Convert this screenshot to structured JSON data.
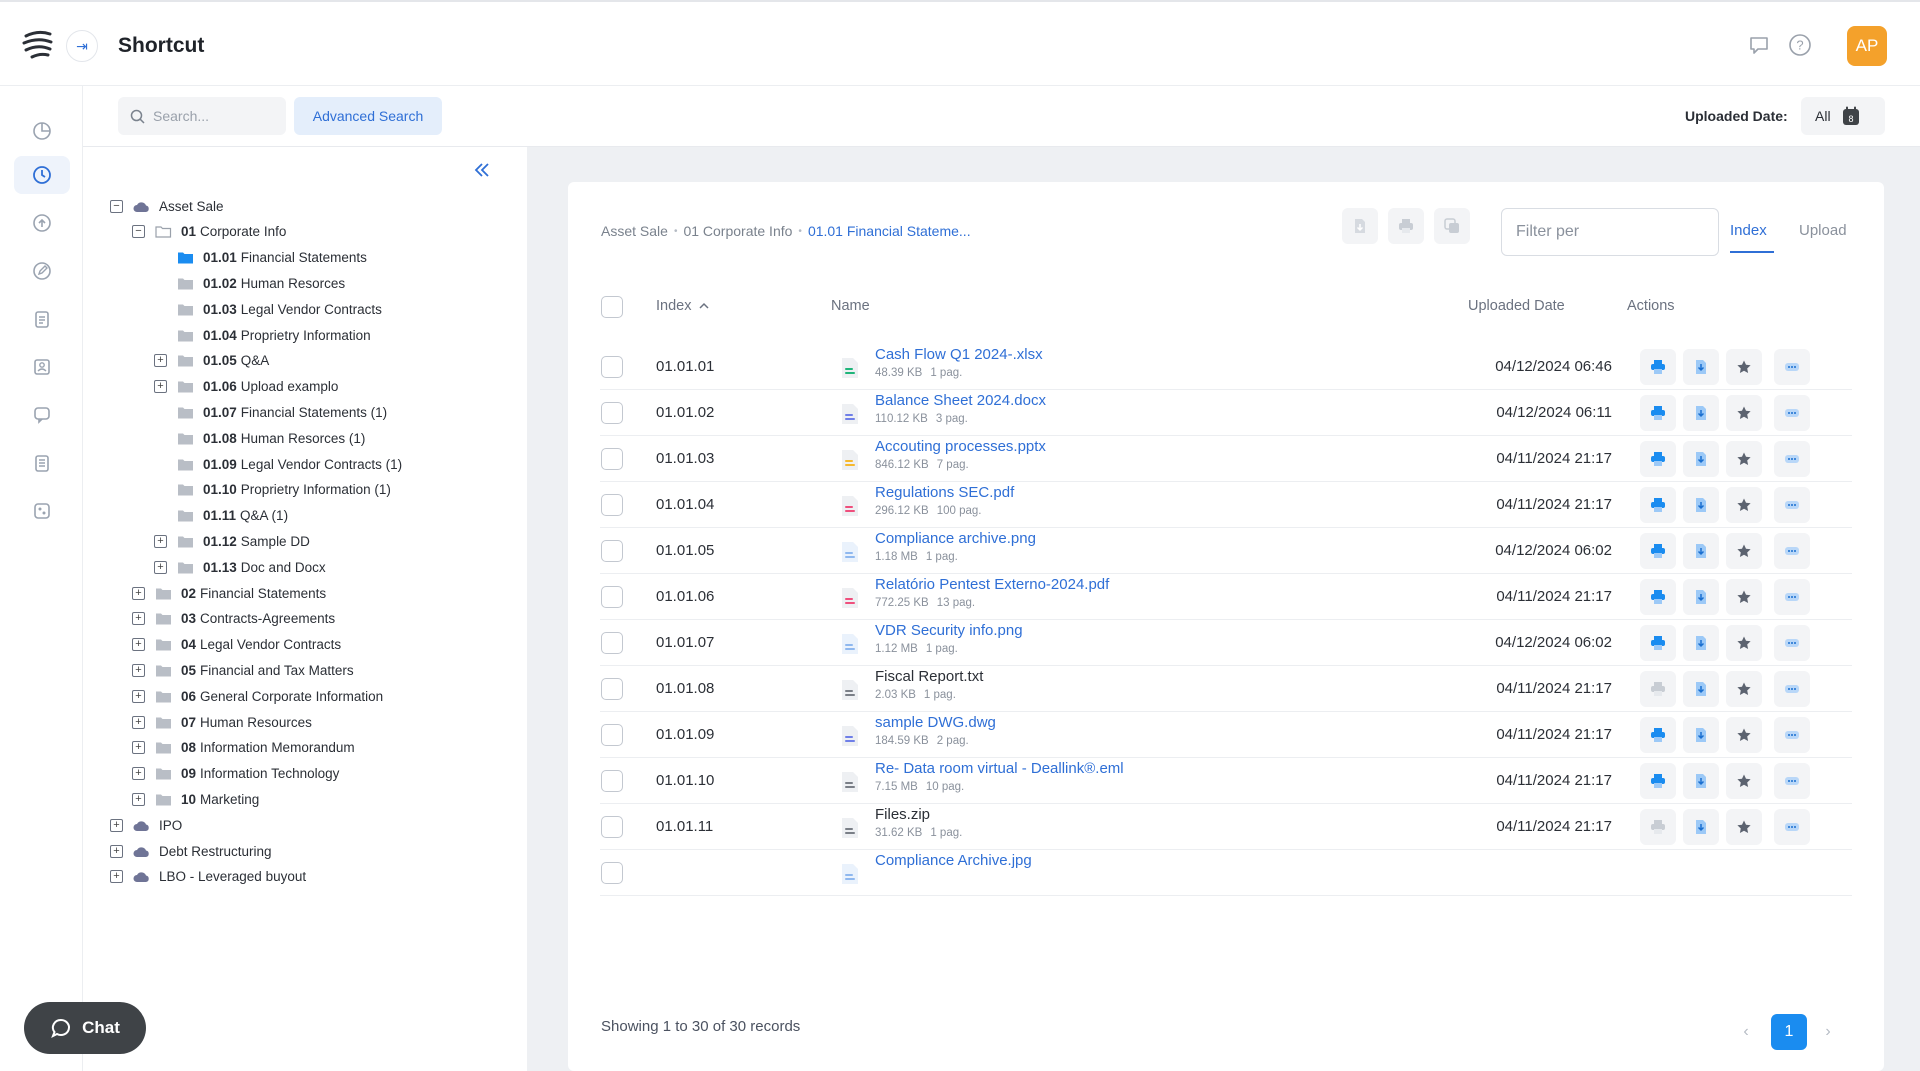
{
  "app": {
    "title": "Shortcut",
    "avatar_initials": "AP",
    "accent": "#2f6fd6",
    "avatar_color": "#f4a12b"
  },
  "search": {
    "placeholder": "Search...",
    "advanced_label": "Advanced Search"
  },
  "uploaded_filter": {
    "label": "Uploaded Date:",
    "value": "All",
    "calendar_day": "8"
  },
  "rail_icons": [
    "pie-chart-icon",
    "clock-icon",
    "upload-icon",
    "edit-icon",
    "clipboard-icon",
    "user-card-icon",
    "chat-bubbles-icon",
    "document-icon",
    "settings-grid-icon"
  ],
  "tree": [
    {
      "level": 0,
      "toggle": "−",
      "type": "cloud",
      "num": "",
      "label": "Asset Sale"
    },
    {
      "level": 1,
      "toggle": "−",
      "type": "folder-open",
      "num": "01",
      "label": "Corporate Info"
    },
    {
      "level": 2,
      "toggle": "",
      "type": "folder-blue",
      "num": "01.01",
      "label": "Financial Statements"
    },
    {
      "level": 2,
      "toggle": "",
      "type": "folder",
      "num": "01.02",
      "label": "Human Resorces"
    },
    {
      "level": 2,
      "toggle": "",
      "type": "folder",
      "num": "01.03",
      "label": "Legal Vendor Contracts"
    },
    {
      "level": 2,
      "toggle": "",
      "type": "folder",
      "num": "01.04",
      "label": "Proprietry Information"
    },
    {
      "level": 2,
      "toggle": "+",
      "type": "folder",
      "num": "01.05",
      "label": "Q&A"
    },
    {
      "level": 2,
      "toggle": "+",
      "type": "folder",
      "num": "01.06",
      "label": "Upload examplo"
    },
    {
      "level": 2,
      "toggle": "",
      "type": "folder",
      "num": "01.07",
      "label": "Financial Statements (1)"
    },
    {
      "level": 2,
      "toggle": "",
      "type": "folder",
      "num": "01.08",
      "label": "Human Resorces (1)"
    },
    {
      "level": 2,
      "toggle": "",
      "type": "folder",
      "num": "01.09",
      "label": "Legal Vendor Contracts (1)"
    },
    {
      "level": 2,
      "toggle": "",
      "type": "folder",
      "num": "01.10",
      "label": "Proprietry Information (1)"
    },
    {
      "level": 2,
      "toggle": "",
      "type": "folder",
      "num": "01.11",
      "label": "Q&A (1)"
    },
    {
      "level": 2,
      "toggle": "+",
      "type": "folder",
      "num": "01.12",
      "label": "Sample DD"
    },
    {
      "level": 2,
      "toggle": "+",
      "type": "folder",
      "num": "01.13",
      "label": "Doc and Docx"
    },
    {
      "level": 1,
      "toggle": "+",
      "type": "folder",
      "num": "02",
      "label": "Financial Statements"
    },
    {
      "level": 1,
      "toggle": "+",
      "type": "folder",
      "num": "03",
      "label": "Contracts-Agreements"
    },
    {
      "level": 1,
      "toggle": "+",
      "type": "folder",
      "num": "04",
      "label": "Legal Vendor Contracts"
    },
    {
      "level": 1,
      "toggle": "+",
      "type": "folder",
      "num": "05",
      "label": "Financial and Tax Matters"
    },
    {
      "level": 1,
      "toggle": "+",
      "type": "folder",
      "num": "06",
      "label": "General Corporate Information"
    },
    {
      "level": 1,
      "toggle": "+",
      "type": "folder",
      "num": "07",
      "label": "Human Resources"
    },
    {
      "level": 1,
      "toggle": "+",
      "type": "folder",
      "num": "08",
      "label": "Information Memorandum"
    },
    {
      "level": 1,
      "toggle": "+",
      "type": "folder",
      "num": "09",
      "label": "Information Technology"
    },
    {
      "level": 1,
      "toggle": "+",
      "type": "folder",
      "num": "10",
      "label": "Marketing"
    },
    {
      "level": 0,
      "toggle": "+",
      "type": "cloud",
      "num": "",
      "label": "IPO"
    },
    {
      "level": 0,
      "toggle": "+",
      "type": "cloud",
      "num": "",
      "label": "Debt Restructuring"
    },
    {
      "level": 0,
      "toggle": "+",
      "type": "cloud",
      "num": "",
      "label": "LBO - Leveraged buyout"
    }
  ],
  "breadcrumb": [
    "Asset Sale",
    "01 Corporate Info",
    "01.01 Financial Stateme..."
  ],
  "filter": {
    "placeholder": "Filter per"
  },
  "tabs": [
    "Index",
    "Upload"
  ],
  "columns": {
    "index": "Index",
    "name": "Name",
    "date": "Uploaded Date",
    "actions": "Actions"
  },
  "files": [
    {
      "index": "01.01.01",
      "name": "Cash Flow Q1 2024-.xlsx",
      "size": "48.39 KB",
      "pages": "1 pag.",
      "date": "04/12/2024 06:46",
      "kind": "xlsx",
      "link": true
    },
    {
      "index": "01.01.02",
      "name": "Balance Sheet 2024.docx",
      "size": "110.12 KB",
      "pages": "3 pag.",
      "date": "04/12/2024 06:11",
      "kind": "docx",
      "link": true
    },
    {
      "index": "01.01.03",
      "name": "Accouting processes.pptx",
      "size": "846.12 KB",
      "pages": "7 pag.",
      "date": "04/11/2024 21:17",
      "kind": "pptx",
      "link": true
    },
    {
      "index": "01.01.04",
      "name": "Regulations SEC.pdf",
      "size": "296.12 KB",
      "pages": "100 pag.",
      "date": "04/11/2024 21:17",
      "kind": "pdf",
      "link": true
    },
    {
      "index": "01.01.05",
      "name": "Compliance archive.png",
      "size": "1.18 MB",
      "pages": "1 pag.",
      "date": "04/12/2024 06:02",
      "kind": "png",
      "link": true
    },
    {
      "index": "01.01.06",
      "name": "Relatório Pentest Externo-2024.pdf",
      "size": "772.25 KB",
      "pages": "13 pag.",
      "date": "04/11/2024 21:17",
      "kind": "pdf",
      "link": true
    },
    {
      "index": "01.01.07",
      "name": "VDR Security info.png",
      "size": "1.12 MB",
      "pages": "1 pag.",
      "date": "04/12/2024 06:02",
      "kind": "png",
      "link": true
    },
    {
      "index": "01.01.08",
      "name": "Fiscal Report.txt",
      "size": "2.03 KB",
      "pages": "1 pag.",
      "date": "04/11/2024 21:17",
      "kind": "txt",
      "link": false
    },
    {
      "index": "01.01.09",
      "name": "sample DWG.dwg",
      "size": "184.59 KB",
      "pages": "2 pag.",
      "date": "04/11/2024 21:17",
      "kind": "dwg",
      "link": true
    },
    {
      "index": "01.01.10",
      "name": "Re- Data room virtual - Deallink®.eml",
      "size": "7.15 MB",
      "pages": "10 pag.",
      "date": "04/11/2024 21:17",
      "kind": "eml",
      "link": true
    },
    {
      "index": "01.01.11",
      "name": "Files.zip",
      "size": "31.62 KB",
      "pages": "1 pag.",
      "date": "04/11/2024 21:17",
      "kind": "zip",
      "link": false
    },
    {
      "index": "",
      "name": "Compliance Archive.jpg",
      "size": "",
      "pages": "",
      "date": "",
      "kind": "png",
      "link": true
    }
  ],
  "file_colors": {
    "xlsx": "#1fb57a",
    "docx": "#6f7fe8",
    "pptx": "#f5b82e",
    "pdf": "#ef4f7d",
    "png": "#8fb8ef",
    "txt": "#7a7f87",
    "dwg": "#6f7fe8",
    "eml": "#7a7f87",
    "zip": "#7a7f87"
  },
  "footer": {
    "showing": "Showing 1 to 30 of 30 records",
    "page": "1"
  },
  "chat": {
    "label": "Chat"
  }
}
